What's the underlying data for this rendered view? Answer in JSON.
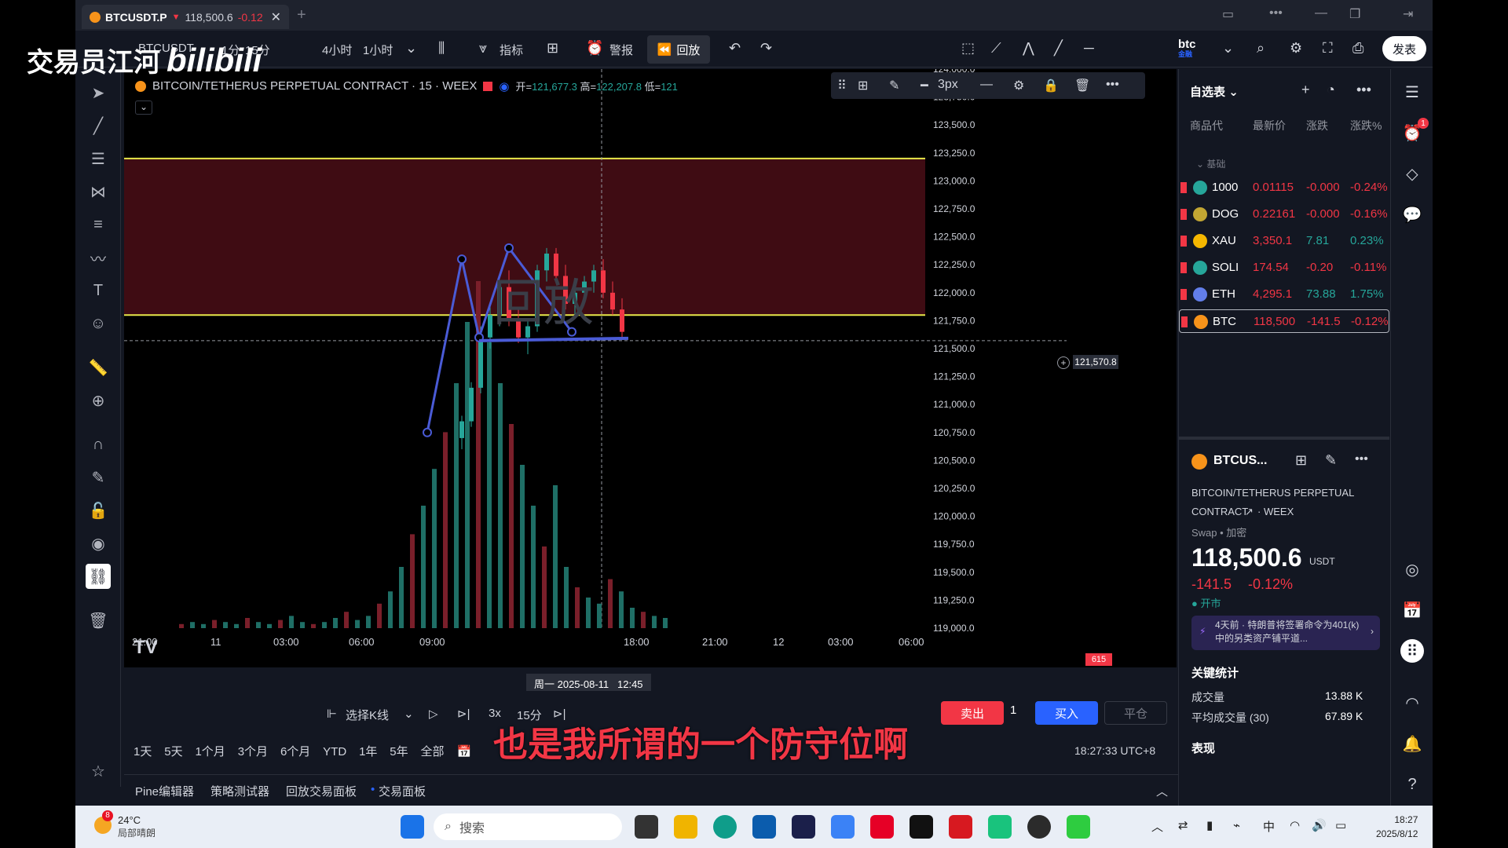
{
  "watermark": {
    "name": "交易员江河",
    "site": "bilibili"
  },
  "subtitle": "也是我所谓的一个防守位啊",
  "tab": {
    "symbol": "BTCUSDT.P",
    "price": "118,500.6",
    "change": "-0.12"
  },
  "toolbar": {
    "symbol": "BTCUSDT",
    "intervals": [
      "1分",
      "15分",
      "4小时",
      "1小时"
    ],
    "indicators_label": "指标",
    "alert_label": "警报",
    "replay_label": "回放",
    "brand": "btc",
    "brand_sub": "金融",
    "publish_label": "发表"
  },
  "chart": {
    "title": "BITCOIN/TETHERUS PERPETUAL CONTRACT · 15 · WEEX",
    "open_label": "开=",
    "open_value": "121,677.3",
    "high_label": "高=",
    "high_value": "122,207.8",
    "low_label": "低=",
    "low_value": "121",
    "stroke_width": "3px",
    "crosshair_price": "121,570.8",
    "volume_tag": "615",
    "crosshair_date": "周一 2025-08-11",
    "crosshair_time": "12:45",
    "background_text": "回放",
    "logo": "TV"
  },
  "chart_data": {
    "type": "candlestick",
    "y_ticks": [
      "124,000.0",
      "123,750.0",
      "123,500.0",
      "123,250.0",
      "123,000.0",
      "122,750.0",
      "122,500.0",
      "122,250.0",
      "122,000.0",
      "121,750.0",
      "121,500.0",
      "121,250.0",
      "121,000.0",
      "120,750.0",
      "120,500.0",
      "120,250.0",
      "120,000.0",
      "119,750.0",
      "119,500.0",
      "119,250.0",
      "119,000.0"
    ],
    "x_ticks": [
      "21:00",
      "11",
      "03:00",
      "06:00",
      "09:00",
      "12:45",
      "18:00",
      "21:00",
      "12",
      "03:00",
      "06:00"
    ],
    "ylim": [
      119000,
      124000
    ],
    "zone": {
      "top": 123200,
      "bottom": 121800,
      "color": "#8b1a2a"
    },
    "support_line": 121570.8,
    "candles": [
      {
        "o": 120700,
        "h": 120900,
        "l": 120600,
        "c": 120850
      },
      {
        "o": 120850,
        "h": 121200,
        "l": 120800,
        "c": 121150
      },
      {
        "o": 121150,
        "h": 121700,
        "l": 121100,
        "c": 121600
      },
      {
        "o": 121600,
        "h": 121900,
        "l": 121500,
        "c": 121800
      },
      {
        "o": 121800,
        "h": 122100,
        "l": 121700,
        "c": 122050
      },
      {
        "o": 122050,
        "h": 122200,
        "l": 121700,
        "c": 121750
      },
      {
        "o": 121750,
        "h": 121850,
        "l": 121550,
        "c": 121600
      },
      {
        "o": 121600,
        "h": 121750,
        "l": 121450,
        "c": 121700
      },
      {
        "o": 121700,
        "h": 122250,
        "l": 121650,
        "c": 122200
      },
      {
        "o": 122200,
        "h": 122400,
        "l": 122100,
        "c": 122350
      },
      {
        "o": 122350,
        "h": 122400,
        "l": 122100,
        "c": 122150
      },
      {
        "o": 122150,
        "h": 122250,
        "l": 121850,
        "c": 121900
      },
      {
        "o": 121900,
        "h": 122050,
        "l": 121800,
        "c": 122000
      },
      {
        "o": 122000,
        "h": 122150,
        "l": 121950,
        "c": 122100
      },
      {
        "o": 122100,
        "h": 122250,
        "l": 122000,
        "c": 122200
      },
      {
        "o": 122200,
        "h": 122300,
        "l": 121950,
        "c": 122000
      },
      {
        "o": 122000,
        "h": 122100,
        "l": 121800,
        "c": 121850
      },
      {
        "o": 121850,
        "h": 121950,
        "l": 121600,
        "c": 121650
      }
    ],
    "pattern_points": [
      [
        120750,
        0
      ],
      [
        122300,
        1
      ],
      [
        121600,
        2
      ],
      [
        122400,
        3
      ],
      [
        121650,
        4
      ]
    ]
  },
  "drawbar": {
    "width_label": "3px"
  },
  "replay": {
    "select_bar": "选择K线",
    "speed": "3x",
    "interval": "15分",
    "sell": "卖出",
    "qty": "1",
    "buy": "买入",
    "close": "平仓"
  },
  "ranges": [
    "1天",
    "5天",
    "1个月",
    "3个月",
    "6个月",
    "YTD",
    "1年",
    "5年",
    "全部"
  ],
  "clock": "18:27:33 UTC+8",
  "panels": [
    "Pine编辑器",
    "策略测试器",
    "回放交易面板",
    "交易面板"
  ],
  "watchlist": {
    "title": "自选表",
    "cols": [
      "商品代",
      "最新价",
      "涨跌",
      "涨跌%"
    ],
    "group": "基础",
    "rows": [
      {
        "sym": "1000",
        "last": "0.01115",
        "chg": "-0.000",
        "pct": "-0.24%",
        "color": "#26a69a"
      },
      {
        "sym": "DOG",
        "last": "0.22161",
        "chg": "-0.000",
        "pct": "-0.16%",
        "color": "#c2a633"
      },
      {
        "sym": "XAU",
        "last": "3,350.1",
        "chg": "7.81",
        "pct": "0.23%",
        "color": "#f5b700"
      },
      {
        "sym": "SOLI",
        "last": "174.54",
        "chg": "-0.20",
        "pct": "-0.11%",
        "color": "#26a69a"
      },
      {
        "sym": "ETH",
        "last": "4,295.1",
        "chg": "73.88",
        "pct": "1.75%",
        "color": "#627eea"
      },
      {
        "sym": "BTC",
        "last": "118,500",
        "chg": "-141.5",
        "pct": "-0.12%",
        "color": "#f7931a"
      }
    ]
  },
  "detail": {
    "symbol": "BTCUS...",
    "name_line1": "BITCOIN/TETHERUS PERPETUAL",
    "name_line2": "CONTRACT",
    "exchange": "WEEX",
    "type": "Swap • 加密",
    "price": "118,500.6",
    "currency": "USDT",
    "change": "-141.5",
    "change_pct": "-0.12%",
    "market_status": "开市",
    "news": "4天前 · 特朗普将签署命令为401(k) 中的另类资产铺平道...",
    "stats_title": "关键统计",
    "volume_label": "成交量",
    "volume_value": "13.88 K",
    "avg_volume_label": "平均成交量 (30)",
    "avg_volume_value": "67.89 K",
    "perf_title": "表现"
  },
  "taskbar": {
    "temp": "24°C",
    "weather": "局部晴朗",
    "weather_badge": "8",
    "search_placeholder": "搜索",
    "ime": "中",
    "time": "18:27",
    "date": "2025/8/12"
  }
}
